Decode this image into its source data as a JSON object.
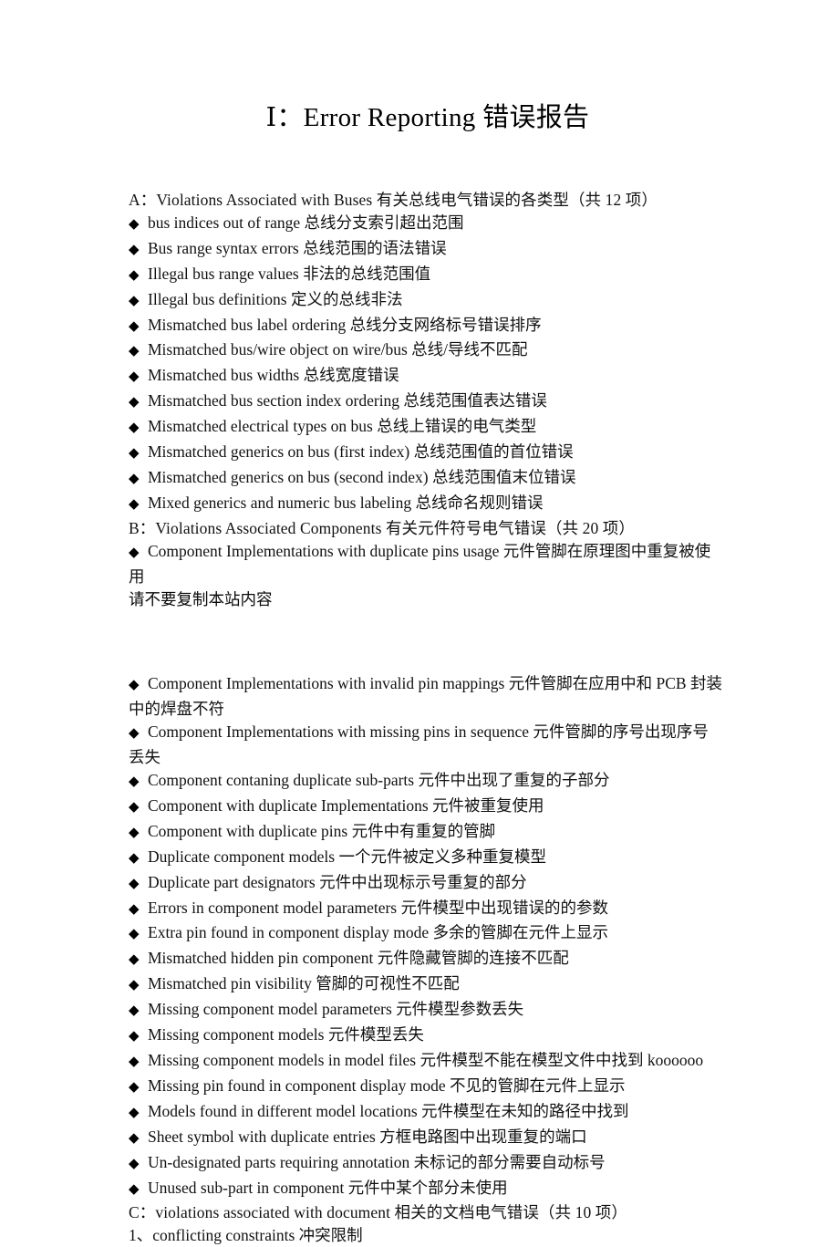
{
  "document": {
    "title": "Ⅰ：Error Reporting  错误报告",
    "bullet_glyph": "◆",
    "sections": [
      {
        "id": "section-a",
        "heading": "A：Violations Associated with Buses  有关总线电气错误的各类型（共 12 项）",
        "items": [
          "bus indices out of range  总线分支索引超出范围",
          "Bus range syntax errors  总线范围的语法错误",
          "Illegal bus range values  非法的总线范围值",
          "Illegal bus definitions  定义的总线非法",
          "Mismatched bus label ordering  总线分支网络标号错误排序",
          "Mismatched bus/wire object on wire/bus  总线/导线不匹配",
          "Mismatched bus widths  总线宽度错误",
          "Mismatched bus section index ordering  总线范围值表达错误",
          "Mismatched electrical types on bus  总线上错误的电气类型",
          "Mismatched generics on bus (first index)  总线范围值的首位错误",
          "Mismatched generics on bus (second index)  总线范围值末位错误",
          "Mixed generics and numeric bus labeling  总线命名规则错误"
        ]
      },
      {
        "id": "section-b",
        "heading": "B：Violations Associated Components  有关元件符号电气错误（共 20 项）",
        "items_before_gap": [
          "Component Implementations with duplicate pins usage  元件管脚在原理图中重复被使用"
        ],
        "notice": "请不要复制本站内容",
        "items_after_gap": [
          "Component Implementations with invalid pin mappings  元件管脚在应用中和 PCB 封装中的焊盘不符",
          "Component Implementations with missing pins in sequence  元件管脚的序号出现序号丢失",
          "Component contaning duplicate sub-parts  元件中出现了重复的子部分",
          "Component with duplicate Implementations  元件被重复使用",
          "Component with duplicate pins  元件中有重复的管脚",
          "Duplicate component models  一个元件被定义多种重复模型",
          "Duplicate part designators  元件中出现标示号重复的部分",
          "Errors in component model parameters  元件模型中出现错误的的参数",
          "Extra pin found in component display mode  多余的管脚在元件上显示",
          "Mismatched hidden pin component  元件隐藏管脚的连接不匹配",
          "Mismatched pin visibility  管脚的可视性不匹配",
          "Missing component model parameters  元件模型参数丢失",
          "Missing component models  元件模型丢失",
          "Missing component models in model files  元件模型不能在模型文件中找到   koooooo",
          "Missing pin found in component display mode  不见的管脚在元件上显示",
          "Models found in different model locations  元件模型在未知的路径中找到",
          "Sheet symbol with duplicate entries  方框电路图中出现重复的端口",
          "Un-designated parts requiring annotation  未标记的部分需要自动标号",
          "Unused sub-part in component  元件中某个部分未使用"
        ]
      },
      {
        "id": "section-c",
        "heading": "C：violations associated with document  相关的文档电气错误（共 10 项）",
        "numbered_items": [
          "1、conflicting constraints  冲突限制"
        ]
      }
    ]
  }
}
